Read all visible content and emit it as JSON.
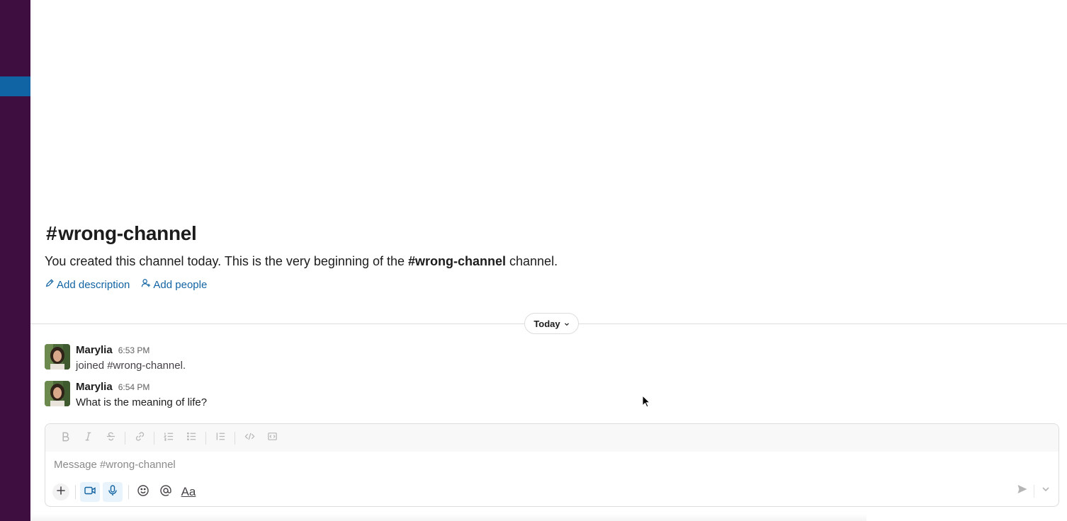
{
  "channel": {
    "hash": "#",
    "name": "wrong-channel"
  },
  "intro": {
    "prefix": "You created this channel today. This is the very beginning of the ",
    "channel_bold": "#wrong-channel",
    "suffix": " channel."
  },
  "actions": {
    "add_description": "Add description",
    "add_people": "Add people"
  },
  "date_divider": {
    "label": "Today"
  },
  "messages": [
    {
      "author": "Marylia",
      "time": "6:53 PM",
      "text": "joined #wrong-channel."
    },
    {
      "author": "Marylia",
      "time": "6:54 PM",
      "text": "What is the meaning of life?"
    }
  ],
  "composer": {
    "placeholder": "Message #wrong-channel",
    "format_icons": [
      "bold-icon",
      "italic-icon",
      "strikethrough-icon",
      "link-icon",
      "ordered-list-icon",
      "bulleted-list-icon",
      "blockquote-icon",
      "code-icon",
      "code-block-icon"
    ],
    "bottom_icons": [
      "plus-icon",
      "video-icon",
      "microphone-icon",
      "emoji-icon",
      "mention-icon",
      "formatting-icon"
    ],
    "format_toggle_label": "Aa"
  },
  "colors": {
    "sidebar": "#3f0e40",
    "active_item": "#1164a3",
    "link": "#1264a3"
  }
}
